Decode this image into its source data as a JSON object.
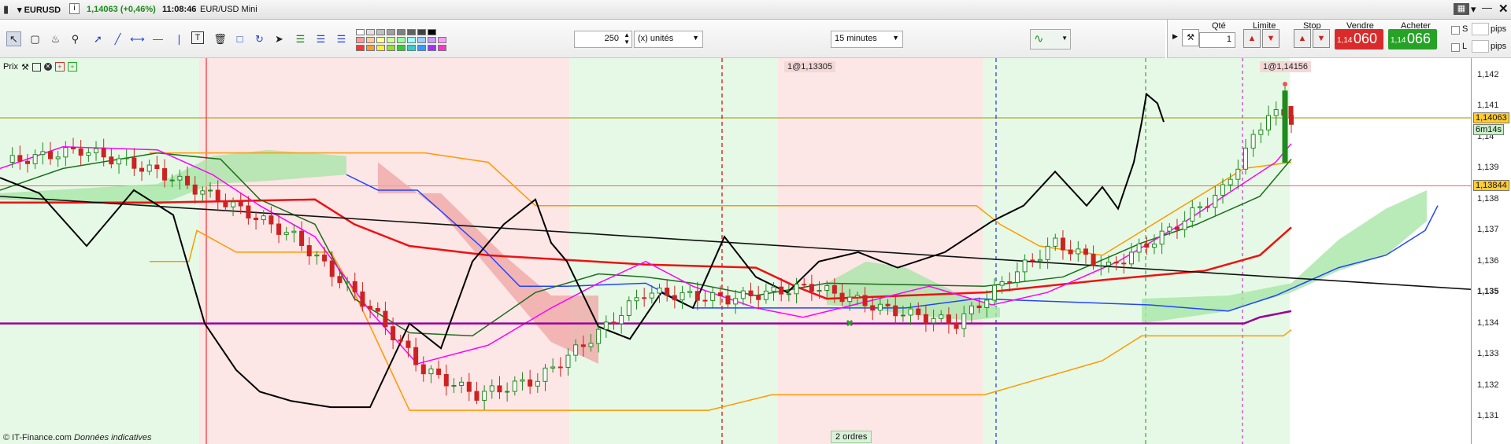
{
  "window": {
    "symbol": "EURUSD",
    "info_icon": "info-icon",
    "price_change": "1,14063 (+0,46%)",
    "time": "11:08:46",
    "title": "EUR/USD Mini"
  },
  "toolbar": {
    "quantity_value": "250",
    "unit_label": "(x) unités",
    "timeframe": "15 minutes",
    "tools": [
      "pointer-icon",
      "ruler-icon",
      "alert-bell-icon",
      "zoom-icon",
      "line-tool-icon",
      "line-tool-2-icon",
      "horizontal-line-icon",
      "segment-icon",
      "vertical-line-icon",
      "text-tool-icon",
      "trash-icon",
      "rectangle-tool-icon",
      "cycle-tool-icon",
      "arrow-tool-icon",
      "fibonacci-icon",
      "fibonacci-2-icon",
      "channel-icon"
    ],
    "colors": {
      "greys": [
        "#ffffff",
        "#e0e0e0",
        "#c0c0c0",
        "#a0a0a0",
        "#808080",
        "#606060",
        "#404040",
        "#000000"
      ],
      "rows1": [
        "#ff9999",
        "#ffcc99",
        "#ffff99",
        "#ccff99",
        "#99ff99",
        "#99ffff",
        "#99ccff",
        "#cc99ff",
        "#ff99ff"
      ],
      "rows2": [
        "#ff3333",
        "#ff9933",
        "#ffee33",
        "#99dd33",
        "#33cc33",
        "#33cccc",
        "#3399ff",
        "#9933ff",
        "#ff33cc"
      ]
    }
  },
  "order_panel": {
    "qty_label": "Qté",
    "qty_value": "1",
    "limit_label": "Limite",
    "stop_label": "Stop",
    "sell_label": "Vendre",
    "buy_label": "Acheter",
    "sell_small": "1,14",
    "sell_big": "060",
    "buy_small": "1,14",
    "buy_big": "066",
    "opt_s": "S",
    "opt_l": "L",
    "pips1": "pips",
    "pips2": "pips"
  },
  "chart": {
    "legend_label": "Prix",
    "marker1": "1@1,13305",
    "marker2": "1@1,14156",
    "orders_badge": "2 ordres",
    "footer_brand": "© IT-Finance.com",
    "footer_note": "Données indicatives",
    "axis_ticks": [
      "1,142",
      "1,141",
      "1,14",
      "1,139",
      "1,138",
      "1,137",
      "1,136",
      "1,135",
      "1,134",
      "1,133",
      "1,132",
      "1,131"
    ],
    "axis_bold": "1,135",
    "current_price": "1,14063",
    "countdown": "6m14s",
    "line_price": "1,13844",
    "colors": {
      "zone_green": "#e6f9e6",
      "zone_red": "#fde6e6",
      "cloud_up": "#a8e6a8",
      "cloud_down": "#f0a8a8",
      "price_line": "#000000",
      "tenkan": "#ff00ff",
      "kijun": "#1b6e1b",
      "ma_red": "#ee1111",
      "ssb_blue": "#2244ff",
      "orange": "#ff9900",
      "purple": "#990099"
    }
  }
}
